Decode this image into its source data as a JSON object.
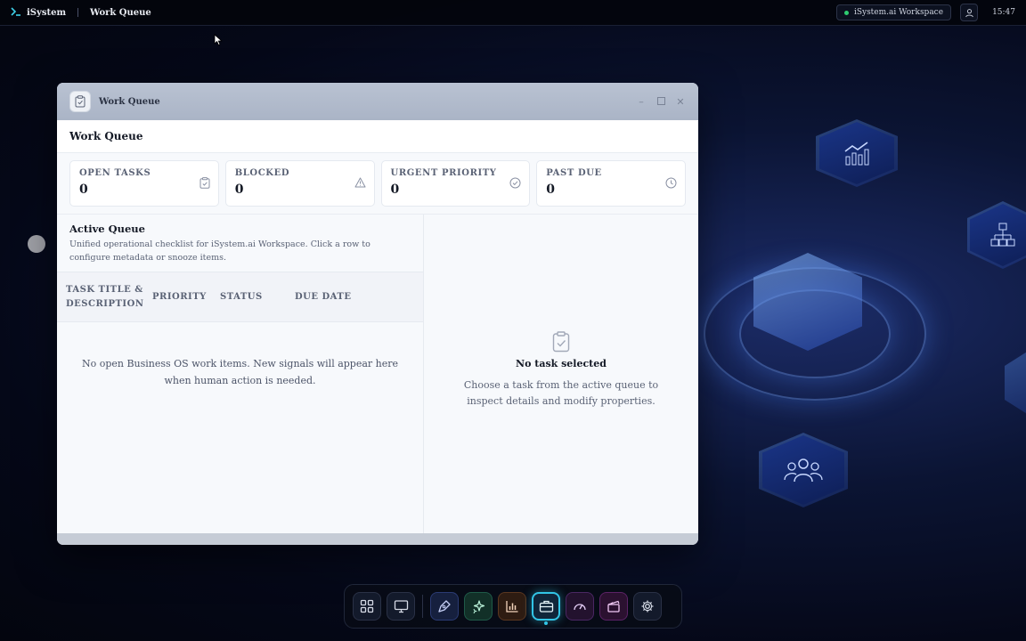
{
  "topbar": {
    "brand": "iSystem",
    "title": "Work Queue",
    "workspace": "iSystem.ai Workspace",
    "clock": "15:47"
  },
  "window": {
    "title": "Work Queue",
    "header": "Work Queue"
  },
  "stats": [
    {
      "label": "OPEN TASKS",
      "value": "0",
      "icon": "clipboard-icon"
    },
    {
      "label": "BLOCKED",
      "value": "0",
      "icon": "warning-icon"
    },
    {
      "label": "URGENT PRIORITY",
      "value": "0",
      "icon": "check-circle-icon"
    },
    {
      "label": "PAST DUE",
      "value": "0",
      "icon": "clock-icon"
    }
  ],
  "queue": {
    "title": "Active Queue",
    "description": "Unified operational checklist for iSystem.ai Workspace. Click a row to configure metadata or snooze items.",
    "columns": {
      "title": "TASK TITLE & DESCRIPTION",
      "priority": "PRIORITY",
      "status": "STATUS",
      "due": "DUE DATE"
    },
    "empty": "No open Business OS work items. New signals will appear here when human action is needed."
  },
  "detail": {
    "empty_title": "No task selected",
    "empty_desc": "Choose a task from the active queue to inspect details and modify properties."
  },
  "dock": {
    "items": [
      "apps-grid-icon",
      "monitor-icon",
      "pen-tool-icon",
      "sparkles-icon",
      "bar-chart-icon",
      "briefcase-icon",
      "gauge-icon",
      "clapperboard-icon",
      "gear-icon"
    ],
    "active": "briefcase-icon"
  },
  "colors": {
    "accent": "#32c5e6",
    "status_dot": "#2ecc71"
  }
}
